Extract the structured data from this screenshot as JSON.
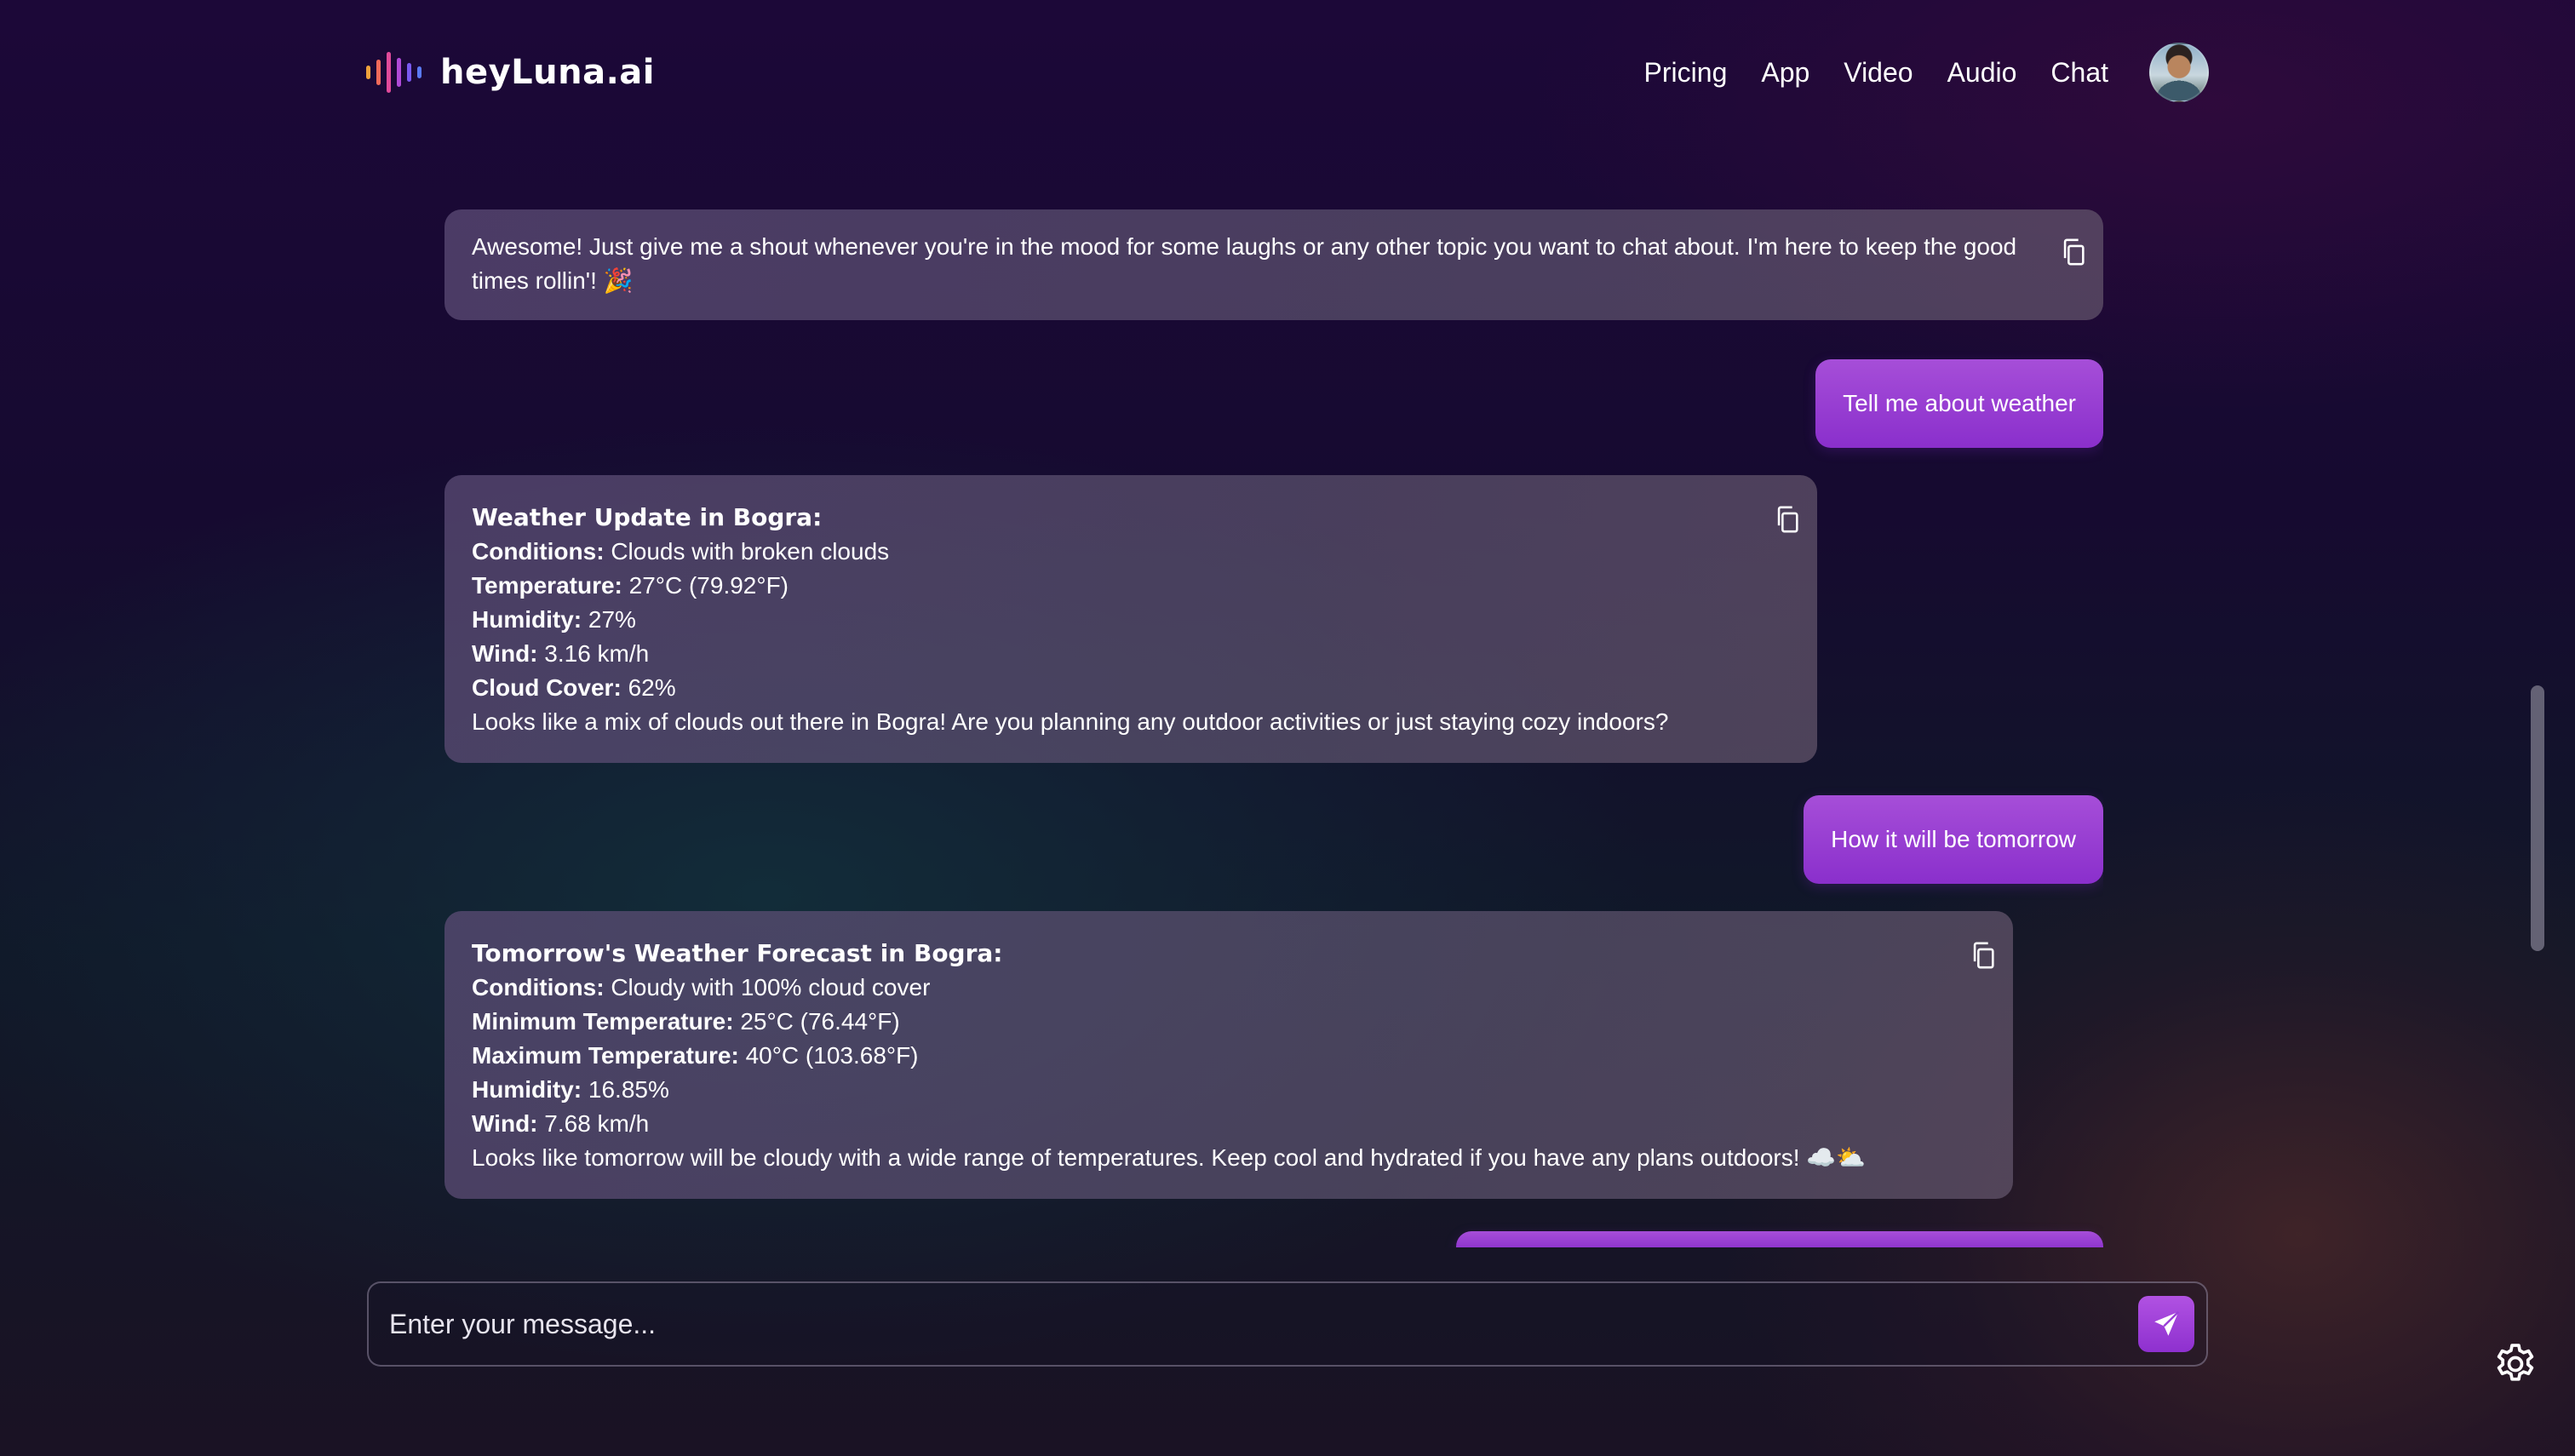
{
  "brand": {
    "name": "heyLuna.ai",
    "logo_colors": [
      "#f0a23c",
      "#f06a5a",
      "#e04a9a",
      "#b04ad8",
      "#7a5af0",
      "#5a7af5"
    ]
  },
  "nav": {
    "items": [
      {
        "label": "Pricing"
      },
      {
        "label": "App"
      },
      {
        "label": "Video"
      },
      {
        "label": "Audio"
      },
      {
        "label": "Chat"
      }
    ],
    "avatar_icon": "user-avatar"
  },
  "messages": [
    {
      "role": "assistant",
      "text": "Awesome! Just give me a shout whenever you're in the mood for some laughs or any other topic you want to chat about. I'm here to keep the good times rollin'! 🎉"
    },
    {
      "role": "user",
      "text": "Tell me about weather"
    },
    {
      "role": "assistant",
      "heading": "Weather Update in Bogra:",
      "rows": [
        {
          "label": "Conditions:",
          "value": "Clouds with broken clouds"
        },
        {
          "label": "Temperature:",
          "value": "27°C (79.92°F)"
        },
        {
          "label": "Humidity:",
          "value": "27%"
        },
        {
          "label": "Wind:",
          "value": "3.16 km/h"
        },
        {
          "label": "Cloud Cover:",
          "value": "62%"
        }
      ],
      "footer": "Looks like a mix of clouds out there in Bogra! Are you planning any outdoor activities or just staying cozy indoors?"
    },
    {
      "role": "user",
      "text": "How it will be tomorrow"
    },
    {
      "role": "assistant",
      "heading": "Tomorrow's Weather Forecast in Bogra:",
      "rows": [
        {
          "label": "Conditions:",
          "value": "Cloudy with 100% cloud cover"
        },
        {
          "label": "Minimum Temperature:",
          "value": "25°C (76.44°F)"
        },
        {
          "label": "Maximum Temperature:",
          "value": "40°C (103.68°F)"
        },
        {
          "label": "Humidity:",
          "value": "16.85%"
        },
        {
          "label": "Wind:",
          "value": "7.68 km/h"
        }
      ],
      "footer": "Looks like tomorrow will be cloudy with a wide range of temperatures. Keep cool and hydrated if you have any plans outdoors! ☁️⛅"
    }
  ],
  "composer": {
    "placeholder": "Enter your message...",
    "value": "",
    "send_icon": "send-icon"
  },
  "icons": {
    "copy": "copy-icon",
    "settings": "gear-icon"
  },
  "colors": {
    "accent": "#9b3fd6",
    "assistant_bubble": "#5c4c76"
  }
}
